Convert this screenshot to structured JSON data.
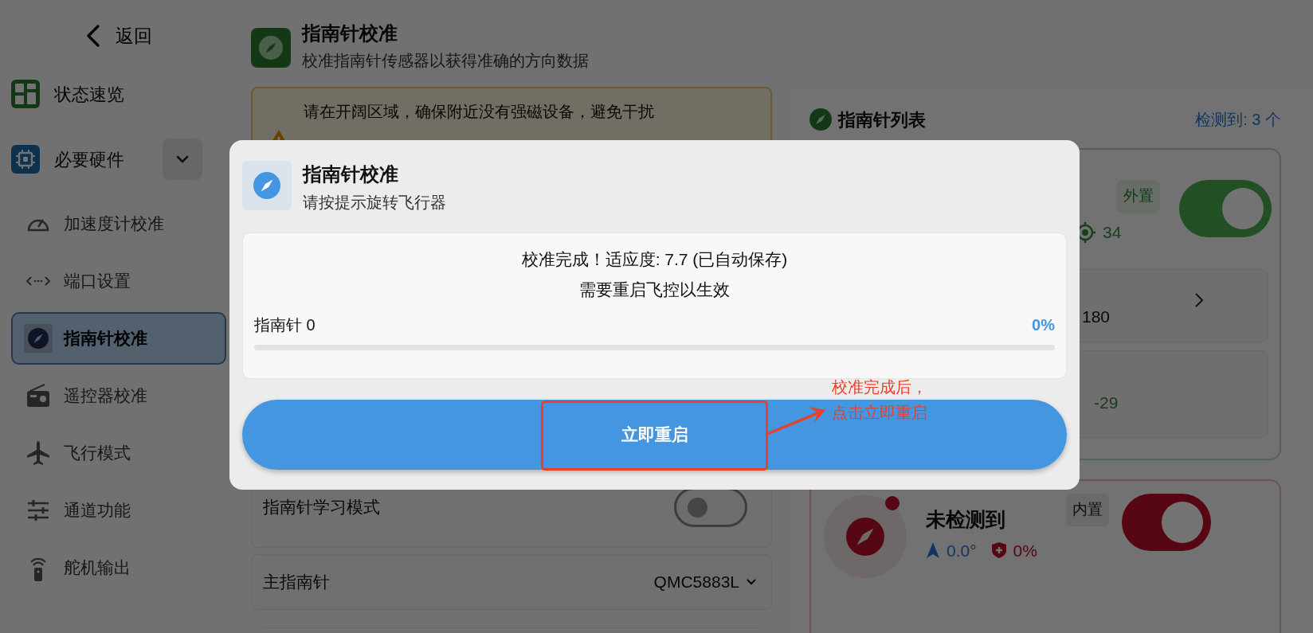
{
  "back": {
    "label": "返回"
  },
  "sidebar": {
    "items": [
      {
        "label": "状态速览",
        "selected": false
      },
      {
        "label": "必要硬件",
        "selected": false,
        "expanded": true,
        "children": [
          {
            "label": "加速度计校准",
            "selected": false
          },
          {
            "label": "端口设置",
            "selected": false
          },
          {
            "label": "指南针校准",
            "selected": true
          },
          {
            "label": "遥控器校准",
            "selected": false
          },
          {
            "label": "飞行模式",
            "selected": false
          },
          {
            "label": "通道功能",
            "selected": false
          },
          {
            "label": "舵机输出",
            "selected": false
          }
        ]
      }
    ]
  },
  "page": {
    "title": "指南针校准",
    "subtitle": "校准指南针传感器以获得准确的方向数据"
  },
  "warning": {
    "text": "请在开阔区域，确保附近没有强磁设备，避免干扰"
  },
  "settings": [
    {
      "kind": "toggle",
      "label": "指南针学习模式",
      "on": false
    },
    {
      "kind": "select",
      "label": "主指南针",
      "value": "QMC5883L"
    }
  ],
  "compass_list": {
    "title": "指南针列表",
    "count": "检测到: 3 个",
    "items": [
      {
        "kind": "ok",
        "mount": "外置",
        "on": true,
        "satellites": "34",
        "rows": [
          {
            "kind": "link",
            "value": "180"
          },
          {
            "kind": "plain",
            "value": "-29"
          }
        ]
      },
      {
        "kind": "error",
        "name": "未检测到",
        "mount": "内置",
        "on": true,
        "heading": "0.0°",
        "health": "0%"
      }
    ]
  },
  "dialog": {
    "title": "指南针校准",
    "subtitle": "请按提示旋转飞行器",
    "message": [
      "校准完成！适应度: 7.7 (已自动保存)",
      "需要重启飞控以生效"
    ],
    "compass": {
      "label": "指南针 0",
      "reading": "0%",
      "level": 0
    },
    "button": "立即重启"
  },
  "annotation": {
    "lines": [
      "校准完成后，",
      "点击立即重启"
    ]
  }
}
